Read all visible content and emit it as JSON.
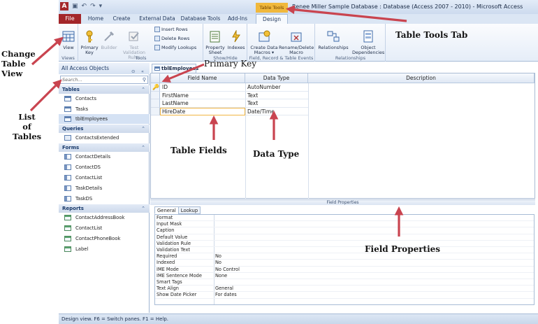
{
  "window": {
    "title": "Renee Miller Sample Database : Database (Access 2007 - 2010)  -  Microsoft Access",
    "context_label": "Table Tools"
  },
  "qat": {
    "app_glyph": "A",
    "icons": [
      "save-icon",
      "undo-icon",
      "redo-icon",
      "customize-icon"
    ]
  },
  "ribbon": {
    "tabs": [
      "File",
      "Home",
      "Create",
      "External Data",
      "Database Tools",
      "Add-Ins",
      "Design"
    ],
    "active_tab": "Design",
    "groups": {
      "views": {
        "label": "Views",
        "view": "View"
      },
      "tools": {
        "label": "Tools",
        "primary_key": "Primary\nKey",
        "builder": "Builder",
        "test_validation": "Test Validation\nRules",
        "insert_rows": "Insert Rows",
        "delete_rows": "Delete Rows",
        "modify_lookups": "Modify Lookups"
      },
      "show_hide": {
        "label": "Show/Hide",
        "property_sheet": "Property\nSheet",
        "indexes": "Indexes"
      },
      "field_events": {
        "label": "Field, Record & Table Events",
        "create_data_macros": "Create Data\nMacros ▾",
        "rename_delete_macro": "Rename/Delete\nMacro"
      },
      "relationships": {
        "label": "Relationships",
        "relationships": "Relationships",
        "object_dependencies": "Object\nDependencies"
      }
    }
  },
  "nav": {
    "title": "All Access Objects",
    "search_placeholder": "Search...",
    "sections": [
      {
        "label": "Tables",
        "items": [
          "Contacts",
          "Tasks",
          "tblEmployees"
        ]
      },
      {
        "label": "Queries",
        "items": [
          "ContactsExtended"
        ]
      },
      {
        "label": "Forms",
        "items": [
          "ContactDetails",
          "ContactDS",
          "ContactList",
          "TaskDetails",
          "TaskDS"
        ]
      },
      {
        "label": "Reports",
        "items": [
          "ContactAddressBook",
          "ContactList",
          "ContactPhoneBook",
          "Label"
        ]
      }
    ],
    "selected_item": "tblEmployees"
  },
  "doc": {
    "tab_label": "tblEmployees",
    "columns": [
      "Field Name",
      "Data Type",
      "Description"
    ],
    "rows": [
      {
        "name": "ID",
        "type": "AutoNumber",
        "primary_key": true
      },
      {
        "name": "FirstName",
        "type": "Text"
      },
      {
        "name": "LastName",
        "type": "Text"
      },
      {
        "name": "HireDate",
        "type": "Date/Time"
      }
    ],
    "field_properties_title": "Field Properties",
    "fp_tabs": [
      "General",
      "Lookup"
    ],
    "properties": [
      {
        "name": "Format",
        "value": ""
      },
      {
        "name": "Input Mask",
        "value": ""
      },
      {
        "name": "Caption",
        "value": ""
      },
      {
        "name": "Default Value",
        "value": ""
      },
      {
        "name": "Validation Rule",
        "value": ""
      },
      {
        "name": "Validation Text",
        "value": ""
      },
      {
        "name": "Required",
        "value": "No"
      },
      {
        "name": "Indexed",
        "value": "No"
      },
      {
        "name": "IME Mode",
        "value": "No Control"
      },
      {
        "name": "IME Sentence Mode",
        "value": "None"
      },
      {
        "name": "Smart Tags",
        "value": ""
      },
      {
        "name": "Text Align",
        "value": "General"
      },
      {
        "name": "Show Date Picker",
        "value": "For dates"
      }
    ]
  },
  "status": {
    "text": "Design view.  F6 = Switch panes.  F1 = Help."
  },
  "annotations": {
    "change_table_view": "Change\nTable\nView",
    "list_of_tables": "List\nof\nTables",
    "primary_key": "Primary Key",
    "table_fields": "Table Fields",
    "data_type": "Data Type",
    "table_tools_tab": "Table Tools Tab",
    "field_properties": "Field Properties"
  },
  "colors": {
    "file_tab": "#a3262a",
    "context_tab": "#f0b83c",
    "annotation_arrow": "#c9444f"
  }
}
